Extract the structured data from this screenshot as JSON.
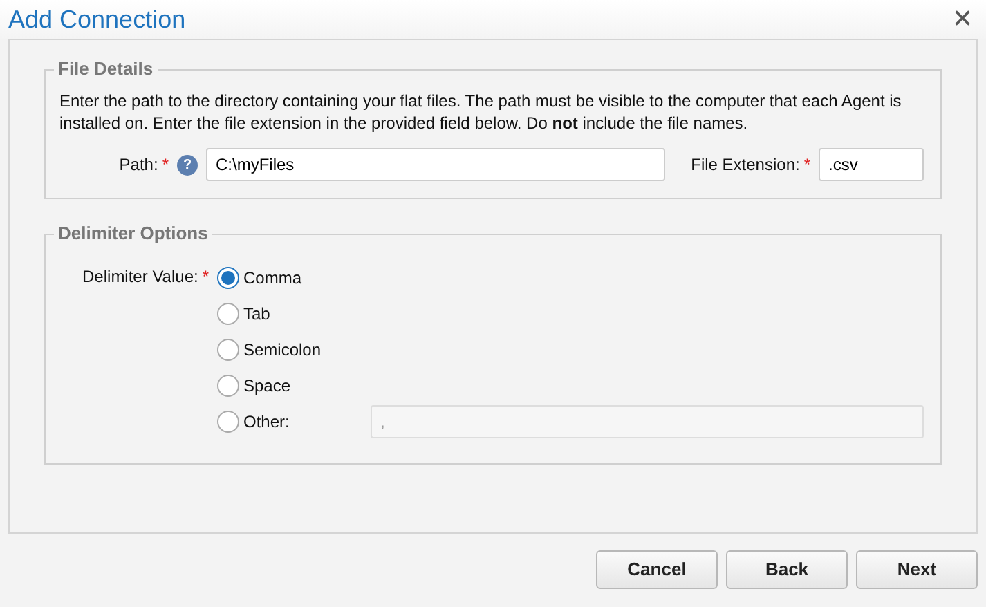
{
  "window": {
    "title": "Add Connection",
    "close": "×"
  },
  "file_details": {
    "legend": "File Details",
    "description": "Enter the path to the directory containing your flat files. The path must be visible to the computer that each Agent is installed on. Enter the file extension in the provided field below. Do **not** include the file names.",
    "path": {
      "label": "Path:",
      "required_marker": "*",
      "help": "?",
      "value": "C:\\myFiles"
    },
    "extension": {
      "label": "File Extension:",
      "required_marker": "*",
      "value": ".csv"
    }
  },
  "delimiter_options": {
    "legend": "Delimiter Options",
    "label": "Delimiter Value:",
    "required_marker": "*",
    "options": [
      {
        "label": "Comma",
        "selected": true
      },
      {
        "label": "Tab",
        "selected": false
      },
      {
        "label": "Semicolon",
        "selected": false
      },
      {
        "label": "Space",
        "selected": false
      },
      {
        "label": "Other:",
        "selected": false,
        "field": {
          "placeholder": ",",
          "disabled": true
        }
      }
    ]
  },
  "buttons": [
    "Cancel",
    "Back",
    "Next"
  ]
}
